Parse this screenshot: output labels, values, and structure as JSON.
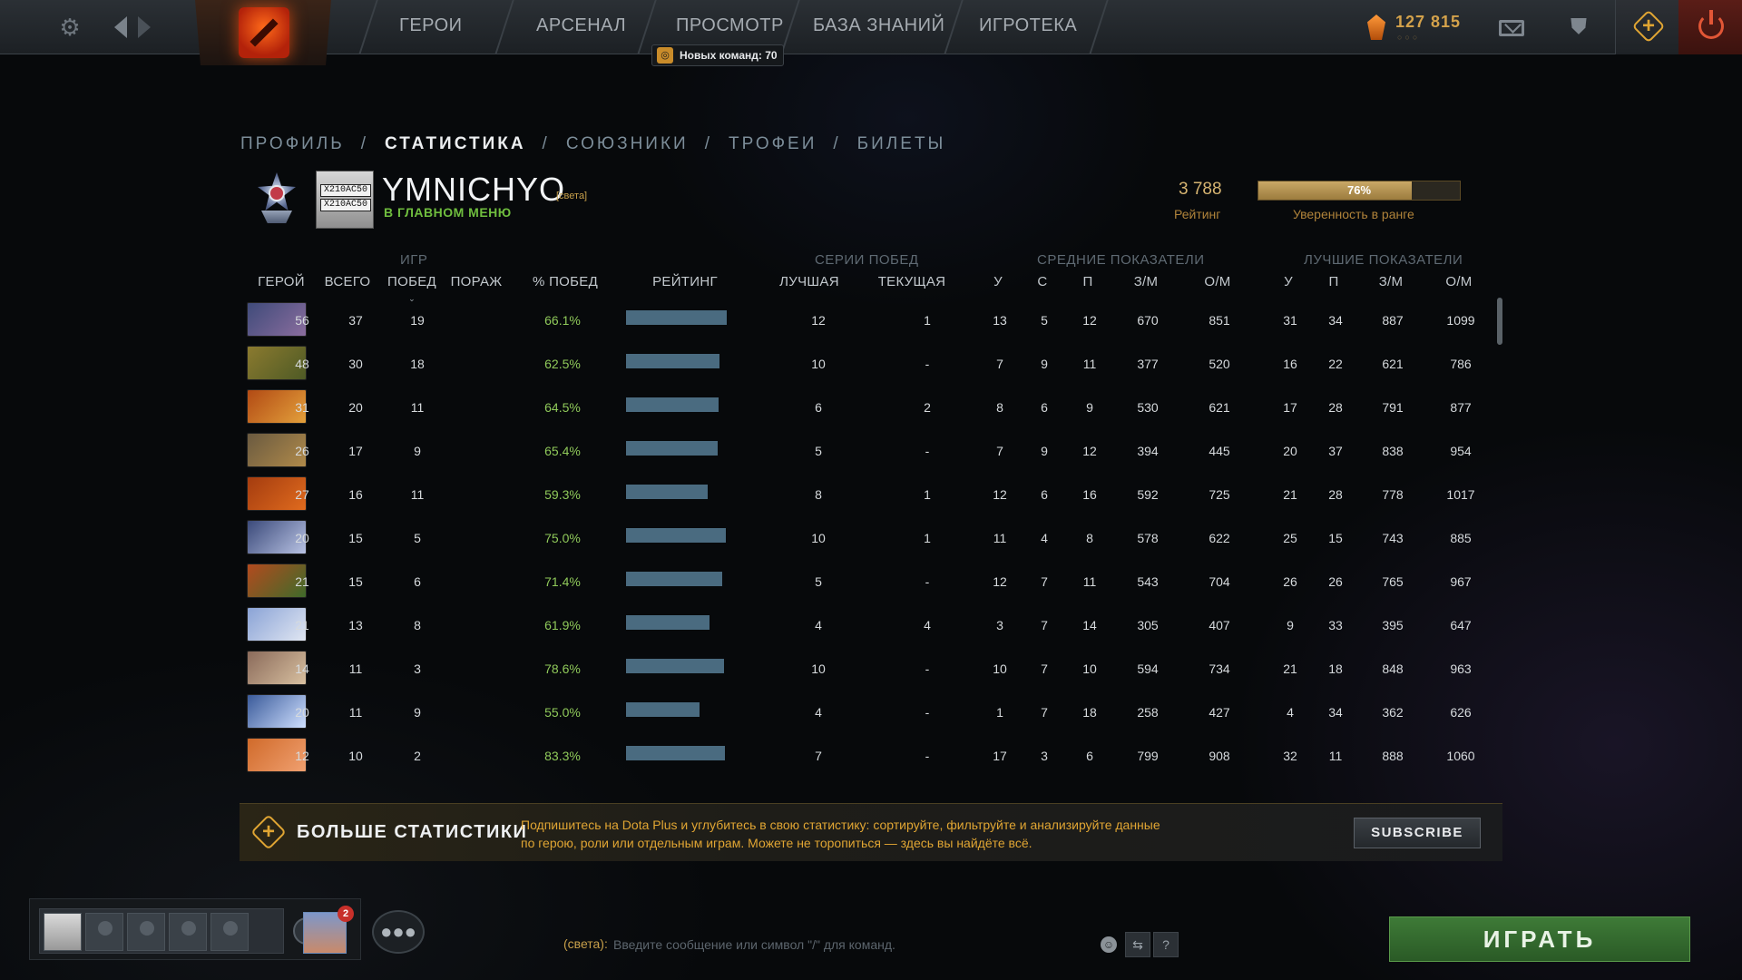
{
  "nav": {
    "items": [
      "ГЕРОИ",
      "АРСЕНАЛ",
      "ПРОСМОТР",
      "БАЗА ЗНАНИЙ",
      "ИГРОТЕКА"
    ],
    "notification": "Новых команд: 70",
    "shards": "127 815"
  },
  "subtabs": [
    "ПРОФИЛЬ",
    "СТАТИСТИКА",
    "СОЮЗНИКИ",
    "ТРОФЕИ",
    "БИЛЕТЫ"
  ],
  "subtab_separator": "/",
  "active_subtab": 1,
  "profile": {
    "name": "YMNICHYO",
    "clan_tag": "[света]",
    "status": "В ГЛАВНОМ МЕНЮ",
    "plate_lines": [
      "X210AC50",
      "X210AC50"
    ],
    "rating_value": "3 788",
    "rating_label": "Рейтинг",
    "confidence_percent": 76,
    "confidence_text": "76%",
    "confidence_label": "Уверенность в ранге"
  },
  "table": {
    "groups": {
      "games": "ИГР",
      "streaks": "СЕРИИ ПОБЕД",
      "averages": "СРЕДНИЕ ПОКАЗАТЕЛИ",
      "bests": "ЛУЧШИЕ ПОКАЗАТЕЛИ"
    },
    "headers": {
      "hero": "ГЕРОЙ",
      "total": "ВСЕГО",
      "wins": "ПОБЕД",
      "losses": "ПОРАЖ",
      "winrate": "% ПОБЕД",
      "rating": "РЕЙТИНГ",
      "best": "ЛУЧШАЯ",
      "current": "ТЕКУЩАЯ",
      "k": "У",
      "d": "С",
      "a": "П",
      "gpm": "З/М",
      "xpm": "О/М"
    },
    "rows": [
      {
        "hero": "hero-1",
        "total": "56",
        "wins": "37",
        "losses": "19",
        "winrate": "66.1%",
        "rating": 0.99,
        "best": "12",
        "current": "1",
        "k": "13",
        "d": "5",
        "a": "12",
        "gpm": "670",
        "xpm": "851",
        "bk": "31",
        "ba": "34",
        "bgpm": "887",
        "bxpm": "1099"
      },
      {
        "hero": "hero-2",
        "total": "48",
        "wins": "30",
        "losses": "18",
        "winrate": "62.5%",
        "rating": 0.92,
        "best": "10",
        "current": "-",
        "k": "7",
        "d": "9",
        "a": "11",
        "gpm": "377",
        "xpm": "520",
        "bk": "16",
        "ba": "22",
        "bgpm": "621",
        "bxpm": "786"
      },
      {
        "hero": "hero-3",
        "total": "31",
        "wins": "20",
        "losses": "11",
        "winrate": "64.5%",
        "rating": 0.91,
        "best": "6",
        "current": "2",
        "k": "8",
        "d": "6",
        "a": "9",
        "gpm": "530",
        "xpm": "621",
        "bk": "17",
        "ba": "28",
        "bgpm": "791",
        "bxpm": "877"
      },
      {
        "hero": "hero-4",
        "total": "26",
        "wins": "17",
        "losses": "9",
        "winrate": "65.4%",
        "rating": 0.9,
        "best": "5",
        "current": "-",
        "k": "7",
        "d": "9",
        "a": "12",
        "gpm": "394",
        "xpm": "445",
        "bk": "20",
        "ba": "37",
        "bgpm": "838",
        "bxpm": "954"
      },
      {
        "hero": "hero-5",
        "total": "27",
        "wins": "16",
        "losses": "11",
        "winrate": "59.3%",
        "rating": 0.8,
        "best": "8",
        "current": "1",
        "k": "12",
        "d": "6",
        "a": "16",
        "gpm": "592",
        "xpm": "725",
        "bk": "21",
        "ba": "28",
        "bgpm": "778",
        "bxpm": "1017"
      },
      {
        "hero": "hero-6",
        "total": "20",
        "wins": "15",
        "losses": "5",
        "winrate": "75.0%",
        "rating": 0.98,
        "best": "10",
        "current": "1",
        "k": "11",
        "d": "4",
        "a": "8",
        "gpm": "578",
        "xpm": "622",
        "bk": "25",
        "ba": "15",
        "bgpm": "743",
        "bxpm": "885"
      },
      {
        "hero": "hero-7",
        "total": "21",
        "wins": "15",
        "losses": "6",
        "winrate": "71.4%",
        "rating": 0.95,
        "best": "5",
        "current": "-",
        "k": "12",
        "d": "7",
        "a": "11",
        "gpm": "543",
        "xpm": "704",
        "bk": "26",
        "ba": "26",
        "bgpm": "765",
        "bxpm": "967"
      },
      {
        "hero": "hero-8",
        "total": "21",
        "wins": "13",
        "losses": "8",
        "winrate": "61.9%",
        "rating": 0.82,
        "best": "4",
        "current": "4",
        "k": "3",
        "d": "7",
        "a": "14",
        "gpm": "305",
        "xpm": "407",
        "bk": "9",
        "ba": "33",
        "bgpm": "395",
        "bxpm": "647"
      },
      {
        "hero": "hero-9",
        "total": "14",
        "wins": "11",
        "losses": "3",
        "winrate": "78.6%",
        "rating": 0.96,
        "best": "10",
        "current": "-",
        "k": "10",
        "d": "7",
        "a": "10",
        "gpm": "594",
        "xpm": "734",
        "bk": "21",
        "ba": "18",
        "bgpm": "848",
        "bxpm": "963"
      },
      {
        "hero": "hero-10",
        "total": "20",
        "wins": "11",
        "losses": "9",
        "winrate": "55.0%",
        "rating": 0.72,
        "best": "4",
        "current": "-",
        "k": "1",
        "d": "7",
        "a": "18",
        "gpm": "258",
        "xpm": "427",
        "bk": "4",
        "ba": "34",
        "bgpm": "362",
        "bxpm": "626"
      },
      {
        "hero": "hero-11",
        "total": "12",
        "wins": "10",
        "losses": "2",
        "winrate": "83.3%",
        "rating": 0.97,
        "best": "7",
        "current": "-",
        "k": "17",
        "d": "3",
        "a": "6",
        "gpm": "799",
        "xpm": "908",
        "bk": "32",
        "ba": "11",
        "bgpm": "888",
        "bxpm": "1060"
      }
    ]
  },
  "dota_plus": {
    "title": "БОЛЬШЕ СТАТИСТИКИ",
    "text_line1": "Подпишитесь на Dota Plus и углубитесь в свою статистику: сортируйте, фильтруйте и анализируйте данные",
    "text_line2": "по герою, роли или отдельным играм. Можете не торопиться — здесь вы найдёте всё.",
    "button": "SUBSCRIBE"
  },
  "bottom": {
    "badge_count": "2",
    "chat_prefix": "(света):",
    "chat_placeholder": "Введите сообщение или символ \"/\" для команд.",
    "help_label": "?",
    "play_label": "ИГРАТЬ"
  },
  "colors": {
    "accent_gold": "#e0a533",
    "win_green": "#8fc95a",
    "rating_bar": "#4a6b80",
    "play_green": "#3e7a37"
  }
}
